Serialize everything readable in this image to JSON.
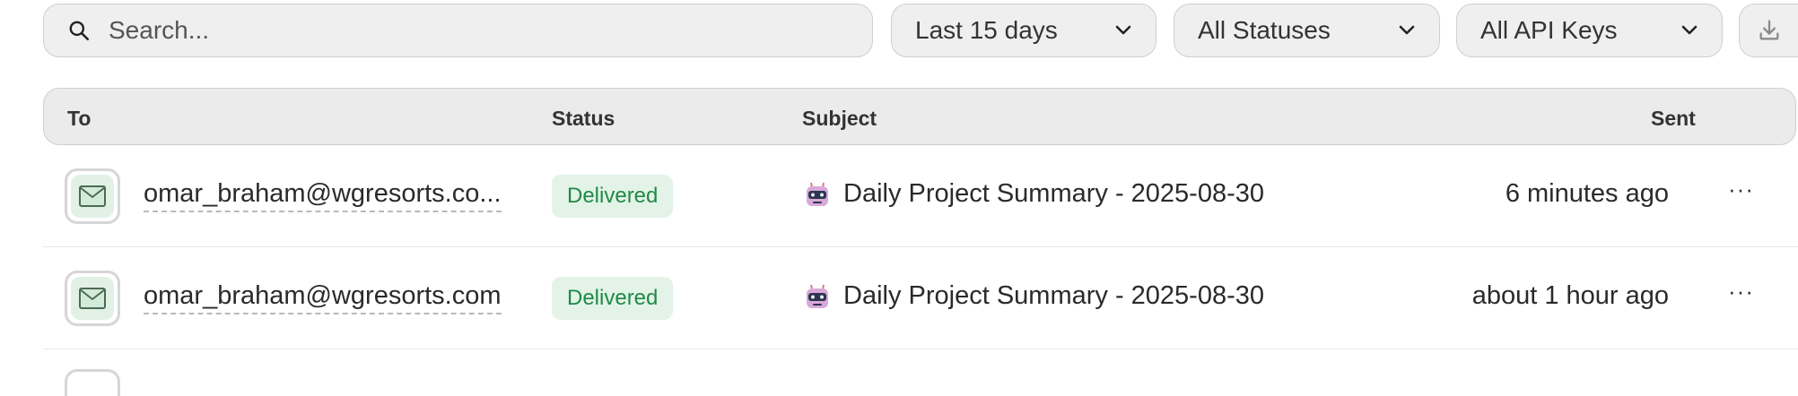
{
  "toolbar": {
    "search_placeholder": "Search...",
    "date_filter": "Last 15 days",
    "status_filter": "All Statuses",
    "api_key_filter": "All API Keys"
  },
  "table": {
    "columns": {
      "to": "To",
      "status": "Status",
      "subject": "Subject",
      "sent": "Sent"
    },
    "rows": [
      {
        "to": "omar_braham@wgresorts.co...",
        "status": "Delivered",
        "subject": "Daily Project Summary - 2025-08-30",
        "sent": "6 minutes ago",
        "more": "···"
      },
      {
        "to": "omar_braham@wgresorts.com",
        "status": "Delivered",
        "subject": "Daily Project Summary - 2025-08-30",
        "sent": "about 1 hour ago",
        "more": "···"
      }
    ]
  },
  "colors": {
    "delivered_bg": "#e3f3e7",
    "delivered_text": "#1f8a46",
    "control_bg": "#efefef",
    "border": "#cfcfcf"
  },
  "icons": {
    "search": "search-icon",
    "chevron": "chevron-down-icon",
    "download": "download-icon",
    "mail": "mail-icon",
    "robot": "robot-icon",
    "more": "more-icon"
  }
}
